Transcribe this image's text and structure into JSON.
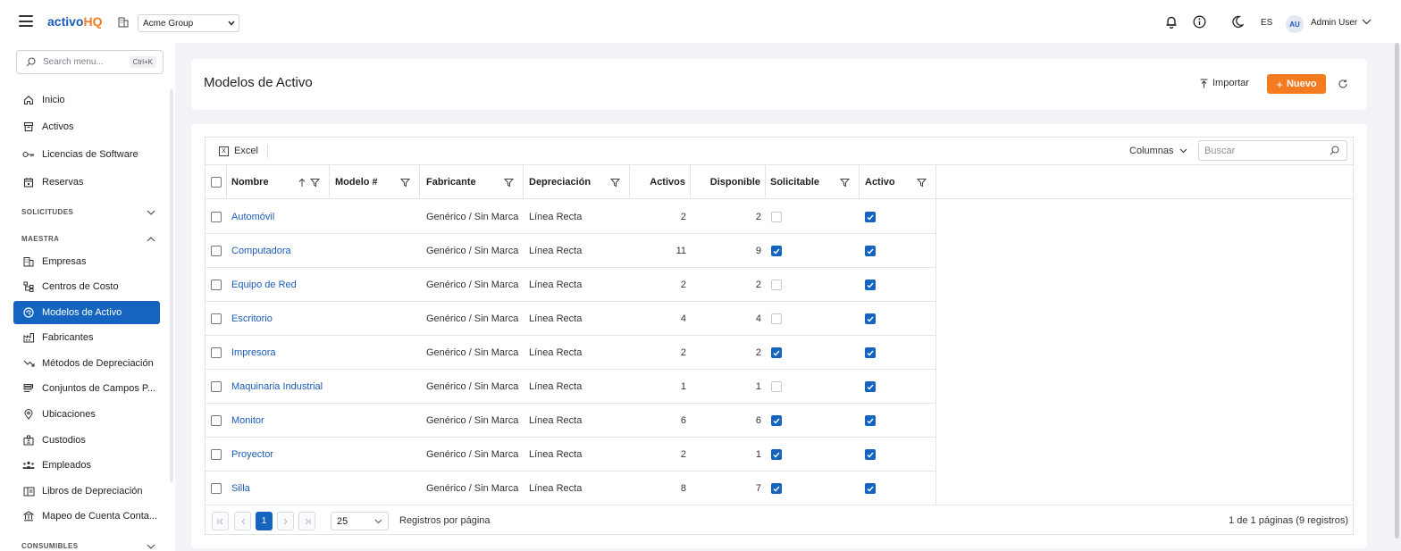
{
  "app": {
    "logo_part1": "activo",
    "logo_part2": "HQ"
  },
  "company": {
    "selected": "Acme Group"
  },
  "user": {
    "lang": "ES",
    "initials": "AU",
    "name": "Admin User"
  },
  "sidebar": {
    "search_placeholder": "Search menu...",
    "search_shortcut": "Ctrl+K",
    "items_top": [
      {
        "label": "Inicio",
        "icon": "home-icon"
      },
      {
        "label": "Activos",
        "icon": "archive-icon"
      },
      {
        "label": "Licencias de Software",
        "icon": "key-icon"
      },
      {
        "label": "Reservas",
        "icon": "calendar-icon"
      }
    ],
    "section_solicitudes": "SOLICITUDES",
    "section_maestra": "MAESTRA",
    "items_maestra": [
      {
        "label": "Empresas",
        "icon": "building-icon"
      },
      {
        "label": "Centros de Costo",
        "icon": "hierarchy-icon"
      },
      {
        "label": "Modelos de Activo",
        "icon": "model-icon",
        "active": true
      },
      {
        "label": "Fabricantes",
        "icon": "factory-icon"
      },
      {
        "label": "Métodos de Depreciación",
        "icon": "trend-down-icon"
      },
      {
        "label": "Conjuntos de Campos P...",
        "icon": "fields-icon"
      },
      {
        "label": "Ubicaciones",
        "icon": "location-pin-icon"
      },
      {
        "label": "Custodios",
        "icon": "badge-icon"
      },
      {
        "label": "Empleados",
        "icon": "people-icon"
      },
      {
        "label": "Libros de Depreciación",
        "icon": "book-icon"
      },
      {
        "label": "Mapeo de Cuenta Conta...",
        "icon": "bank-icon"
      }
    ],
    "section_consumibles": "CONSUMIBLES"
  },
  "header": {
    "title": "Modelos de Activo",
    "import_label": "Importar",
    "new_label": "Nuevo"
  },
  "grid": {
    "excel_label": "Excel",
    "columns_label": "Columnas",
    "search_placeholder": "Buscar",
    "columns": [
      "Nombre",
      "Modelo #",
      "Fabricante",
      "Depreciación",
      "Activos",
      "Disponible",
      "Solicitable",
      "Activo"
    ],
    "rows": [
      {
        "nombre": "Automóvil",
        "modelo": "",
        "fabricante": "Genérico / Sin Marca",
        "depreciacion": "Línea Recta",
        "activos": "2",
        "disponible": "2",
        "solicitable": false,
        "activo": true
      },
      {
        "nombre": "Computadora",
        "modelo": "",
        "fabricante": "Genérico / Sin Marca",
        "depreciacion": "Línea Recta",
        "activos": "11",
        "disponible": "9",
        "solicitable": true,
        "activo": true
      },
      {
        "nombre": "Equipo de Red",
        "modelo": "",
        "fabricante": "Genérico / Sin Marca",
        "depreciacion": "Línea Recta",
        "activos": "2",
        "disponible": "2",
        "solicitable": false,
        "activo": true
      },
      {
        "nombre": "Escritorio",
        "modelo": "",
        "fabricante": "Genérico / Sin Marca",
        "depreciacion": "Línea Recta",
        "activos": "4",
        "disponible": "4",
        "solicitable": false,
        "activo": true
      },
      {
        "nombre": "Impresora",
        "modelo": "",
        "fabricante": "Genérico / Sin Marca",
        "depreciacion": "Línea Recta",
        "activos": "2",
        "disponible": "2",
        "solicitable": true,
        "activo": true
      },
      {
        "nombre": "Maquinaria Industrial",
        "modelo": "",
        "fabricante": "Genérico / Sin Marca",
        "depreciacion": "Línea Recta",
        "activos": "1",
        "disponible": "1",
        "solicitable": false,
        "activo": true
      },
      {
        "nombre": "Monitor",
        "modelo": "",
        "fabricante": "Genérico / Sin Marca",
        "depreciacion": "Línea Recta",
        "activos": "6",
        "disponible": "6",
        "solicitable": true,
        "activo": true
      },
      {
        "nombre": "Proyector",
        "modelo": "",
        "fabricante": "Genérico / Sin Marca",
        "depreciacion": "Línea Recta",
        "activos": "2",
        "disponible": "1",
        "solicitable": true,
        "activo": true
      },
      {
        "nombre": "Silla",
        "modelo": "",
        "fabricante": "Genérico / Sin Marca",
        "depreciacion": "Línea Recta",
        "activos": "8",
        "disponible": "7",
        "solicitable": true,
        "activo": true
      }
    ]
  },
  "pager": {
    "current_page": "1",
    "per_page": "25",
    "per_page_label": "Registros por página",
    "summary": "1 de 1 páginas (9 registros)"
  },
  "colors": {
    "primary": "#1565c0",
    "accent": "#f47b20"
  }
}
